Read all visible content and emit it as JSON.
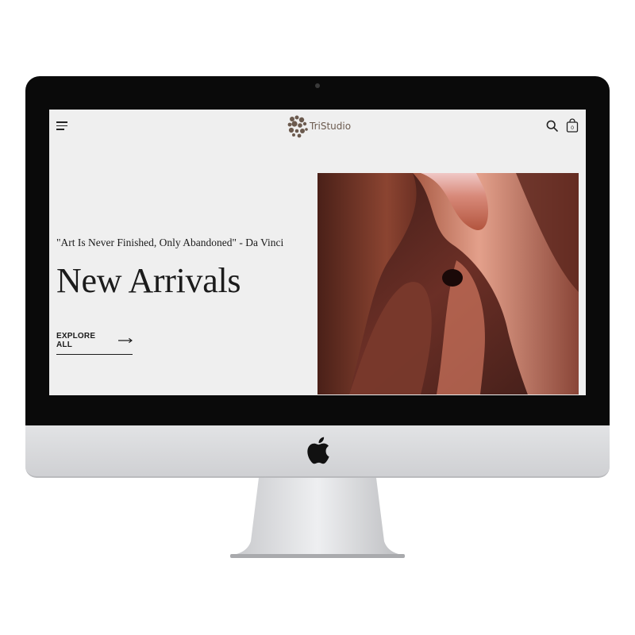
{
  "brand": {
    "name": "TriStudio"
  },
  "hero": {
    "quote": "\"Art Is Never Finished, Only Abandoned\" - Da Vinci",
    "headline": "New Arrivals",
    "cta_label": "EXPLORE ALL"
  },
  "cart": {
    "count": "0"
  },
  "icons": {
    "menu": "hamburger-menu-icon",
    "search": "search-icon",
    "cart": "shopping-bag-icon",
    "cta_arrow": "arrow-right-icon",
    "device": "apple-logo"
  },
  "colors": {
    "screen_bg": "#efefef",
    "text": "#1b1b1b",
    "logo_brown": "#6b5a4e",
    "canyon_dark": "#5a2a22",
    "canyon_light": "#e8a48c"
  }
}
